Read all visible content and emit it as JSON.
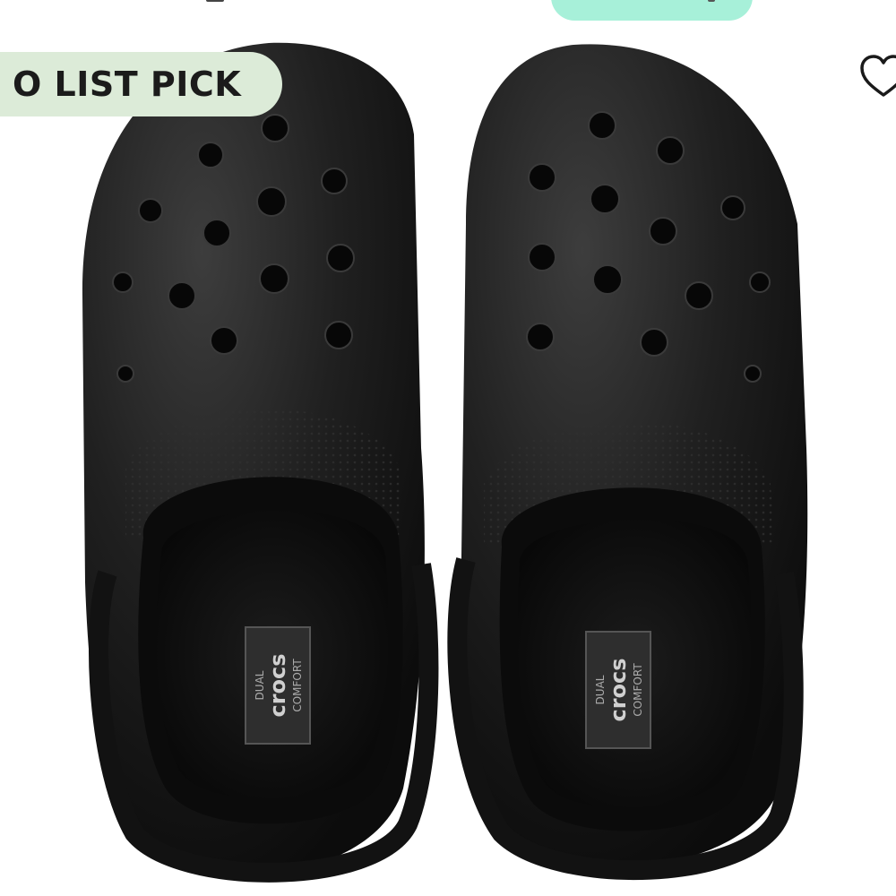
{
  "badge": {
    "label": "O LIST PICK"
  },
  "product": {
    "brand_label": "crocs",
    "insole_top": "DUAL",
    "insole_bottom": "COMFORT"
  },
  "colors": {
    "top_pill": "#a7f0d9",
    "badge_bg": "#dcebd8",
    "clog": "#1a1a1a"
  },
  "icons": {
    "favorite": "heart-outline-icon"
  }
}
